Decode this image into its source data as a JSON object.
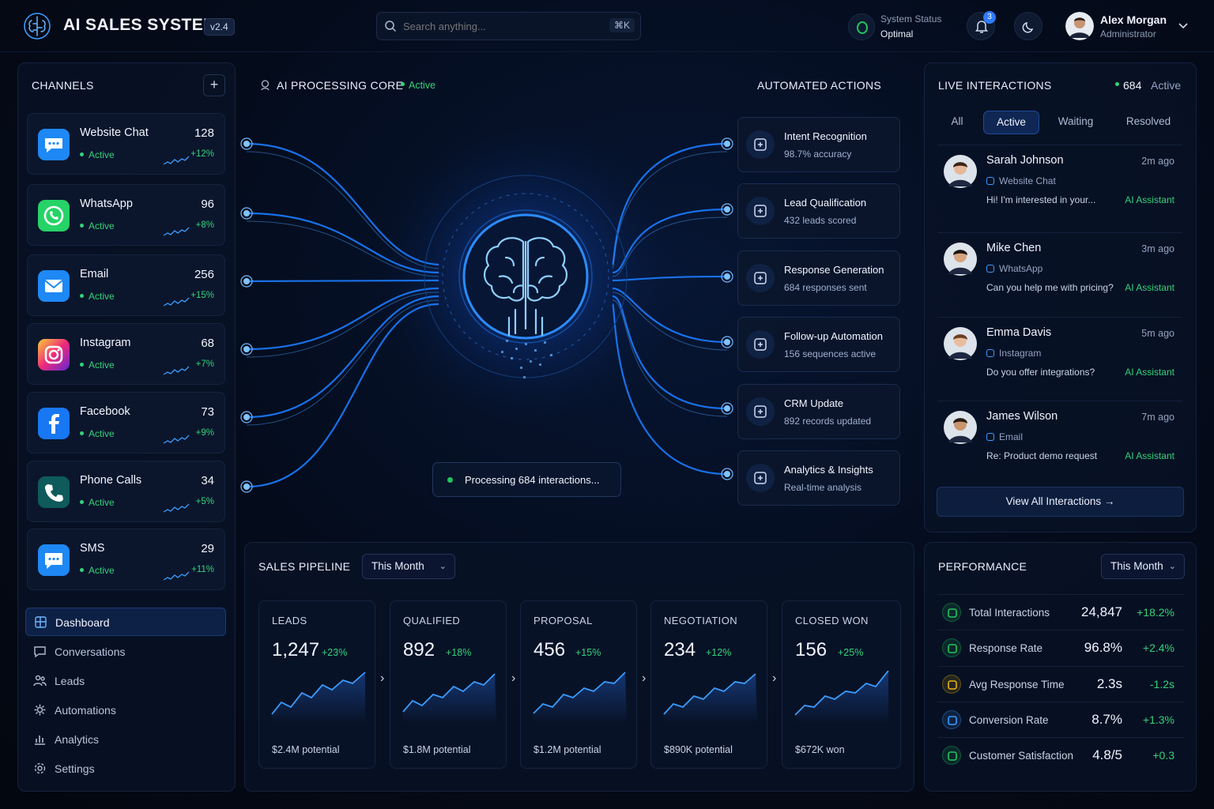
{
  "header": {
    "app_title": "AI SALES SYSTEM",
    "version": "v2.4",
    "search_placeholder": "Search anything...",
    "search_shortcut": "⌘K",
    "system_status_label": "System Status",
    "system_status_value": "Optimal",
    "notification_count": "3",
    "user_name": "Alex Morgan",
    "user_role": "Administrator"
  },
  "channels": {
    "title": "CHANNELS",
    "add_label": "+",
    "items": [
      {
        "name": "Website Chat",
        "status": "Active",
        "count": "128",
        "change": "+12%",
        "icon": "chat-bubble-icon",
        "color": "#1e88f5"
      },
      {
        "name": "WhatsApp",
        "status": "Active",
        "count": "96",
        "change": "+8%",
        "icon": "whatsapp-icon",
        "color": "#25d366"
      },
      {
        "name": "Email",
        "status": "Active",
        "count": "256",
        "change": "+15%",
        "icon": "mail-icon",
        "color": "#1e88f5"
      },
      {
        "name": "Instagram",
        "status": "Active",
        "count": "68",
        "change": "+7%",
        "icon": "instagram-icon",
        "color": "#e1306c"
      },
      {
        "name": "Facebook",
        "status": "Active",
        "count": "73",
        "change": "+9%",
        "icon": "facebook-icon",
        "color": "#1877f2"
      },
      {
        "name": "Phone Calls",
        "status": "Active",
        "count": "34",
        "change": "+5%",
        "icon": "phone-icon",
        "color": "#0f5a5a"
      },
      {
        "name": "SMS",
        "status": "Active",
        "count": "29",
        "change": "+11%",
        "icon": "sms-icon",
        "color": "#1e88f5"
      }
    ]
  },
  "nav": {
    "items": [
      {
        "label": "Dashboard",
        "icon": "dashboard-icon",
        "active": true
      },
      {
        "label": "Conversations",
        "icon": "conversations-icon",
        "active": false
      },
      {
        "label": "Leads",
        "icon": "leads-icon",
        "active": false
      },
      {
        "label": "Automations",
        "icon": "automations-icon",
        "active": false
      },
      {
        "label": "Analytics",
        "icon": "analytics-icon",
        "active": false
      },
      {
        "label": "Settings",
        "icon": "settings-icon",
        "active": false
      }
    ]
  },
  "core": {
    "title": "AI PROCESSING CORE",
    "status": "Active",
    "processing_text": "Processing 684 interactions..."
  },
  "actions": {
    "title": "AUTOMATED ACTIONS",
    "items": [
      {
        "title": "Intent Recognition",
        "sub": "98.7% accuracy",
        "icon": "intent-icon"
      },
      {
        "title": "Lead Qualification",
        "sub": "432 leads scored",
        "icon": "lead-qualification-icon"
      },
      {
        "title": "Response Generation",
        "sub": "684 responses sent",
        "icon": "response-icon"
      },
      {
        "title": "Follow-up Automation",
        "sub": "156 sequences active",
        "icon": "follow-up-icon"
      },
      {
        "title": "CRM Update",
        "sub": "892 records updated",
        "icon": "crm-icon"
      },
      {
        "title": "Analytics & Insights",
        "sub": "Real-time analysis",
        "icon": "analytics-insights-icon"
      }
    ]
  },
  "live": {
    "title": "LIVE INTERACTIONS",
    "count": "684",
    "count_label": "Active",
    "tabs": [
      "All",
      "Active",
      "Waiting",
      "Resolved"
    ],
    "active_tab": "Active",
    "messages": [
      {
        "name": "Sarah Johnson",
        "time": "2m ago",
        "channel": "Website Chat",
        "text": "Hi! I'm interested in your...",
        "handler": "AI Assistant"
      },
      {
        "name": "Mike Chen",
        "time": "3m ago",
        "channel": "WhatsApp",
        "text": "Can you help me with pricing?",
        "handler": "AI Assistant"
      },
      {
        "name": "Emma Davis",
        "time": "5m ago",
        "channel": "Instagram",
        "text": "Do you offer integrations?",
        "handler": "AI Assistant"
      },
      {
        "name": "James Wilson",
        "time": "7m ago",
        "channel": "Email",
        "text": "Re: Product demo request",
        "handler": "AI Assistant"
      }
    ],
    "view_all": "View All Interactions →"
  },
  "pipeline": {
    "title": "SALES PIPELINE",
    "period": "This Month",
    "stages": [
      {
        "label": "LEADS",
        "value": "1,247",
        "change": "+23%",
        "foot": "$2.4M potential"
      },
      {
        "label": "QUALIFIED",
        "value": "892",
        "change": "+18%",
        "foot": "$1.8M potential"
      },
      {
        "label": "PROPOSAL",
        "value": "456",
        "change": "+15%",
        "foot": "$1.2M potential"
      },
      {
        "label": "NEGOTIATION",
        "value": "234",
        "change": "+12%",
        "foot": "$890K potential"
      },
      {
        "label": "CLOSED WON",
        "value": "156",
        "change": "+25%",
        "foot": "$672K won"
      }
    ]
  },
  "performance": {
    "title": "PERFORMANCE",
    "period": "This Month",
    "rows": [
      {
        "label": "Total Interactions",
        "value": "24,847",
        "change": "+18.2%",
        "icon": "interactions-icon",
        "color": "#22c55e"
      },
      {
        "label": "Response Rate",
        "value": "96.8%",
        "change": "+2.4%",
        "icon": "response-rate-icon",
        "color": "#22c55e"
      },
      {
        "label": "Avg Response Time",
        "value": "2.3s",
        "change": "-1.2s",
        "icon": "clock-icon",
        "color": "#eab308"
      },
      {
        "label": "Conversion Rate",
        "value": "8.7%",
        "change": "+1.3%",
        "icon": "conversion-icon",
        "color": "#3b9cff"
      },
      {
        "label": "Customer Satisfaction",
        "value": "4.8/5",
        "change": "+0.3",
        "icon": "star-icon",
        "color": "#22c55e"
      }
    ]
  }
}
